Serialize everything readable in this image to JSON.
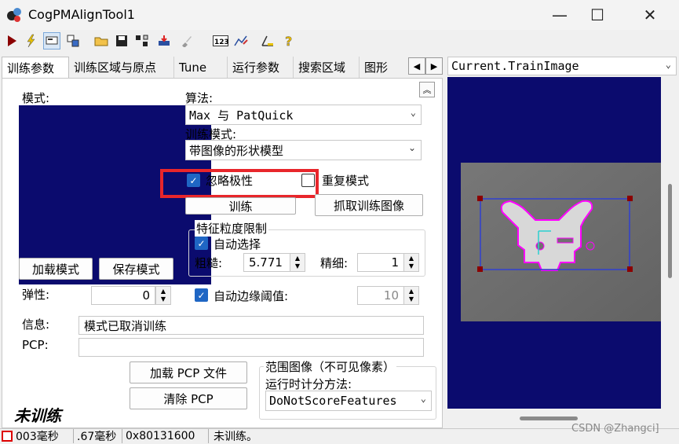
{
  "window": {
    "title": "CogPMAlignTool1",
    "minimize": "—",
    "maximize": "☐",
    "close": "✕"
  },
  "tabs": [
    "训练参数",
    "训练区域与原点",
    "Tune",
    "运行参数",
    "搜索区域",
    "图形"
  ],
  "tab_nav": {
    "prev": "◀",
    "next": "▶"
  },
  "train": {
    "pattern_label": "模式:",
    "algorithm_label": "算法:",
    "algorithm_value": "Max 与 PatQuick",
    "train_mode_label": "训练模式:",
    "train_mode_value": "带图像的形状模型",
    "ignore_polarity_label": "忽略极性",
    "ignore_polarity_checked": true,
    "repeat_mode_label": "重复模式",
    "repeat_mode_checked": false,
    "train_button": "训练",
    "grab_button": "抓取训练图像",
    "load_pattern_button": "加载模式",
    "save_pattern_button": "保存模式",
    "granularity_group": "特征粒度限制",
    "auto_select_label": "自动选择",
    "auto_select_checked": true,
    "coarse_label": "粗糙:",
    "coarse_value": "5.771",
    "fine_label": "精细:",
    "fine_value": "1",
    "elasticity_label": "弹性:",
    "elasticity_value": "0",
    "auto_edge_label": "自动边缘阈值:",
    "auto_edge_checked": true,
    "auto_edge_value": "10",
    "info_label": "信息:",
    "info_value": "模式已取消训练",
    "pcp_label": "PCP:",
    "pcp_value": "",
    "load_pcp_button": "加载 PCP 文件",
    "clear_pcp_button": "清除 PCP",
    "range_group": "范围图像（不可见像素）",
    "scoring_label": "运行时计分方法:",
    "scoring_value": "DoNotScoreFeatures",
    "untrained_text": "未训练"
  },
  "image_view": {
    "selector": "Current.TrainImage"
  },
  "status": {
    "time1": "003毫秒",
    "time2": ".67毫秒",
    "code": "0x80131600",
    "message": "未训练。"
  },
  "watermark": "CSDN @Zhangci]",
  "colors": {
    "navy": "#0b0b6e",
    "highlight": "#e8262b",
    "check": "#1f66c4",
    "overlay": "#ff00ff"
  }
}
